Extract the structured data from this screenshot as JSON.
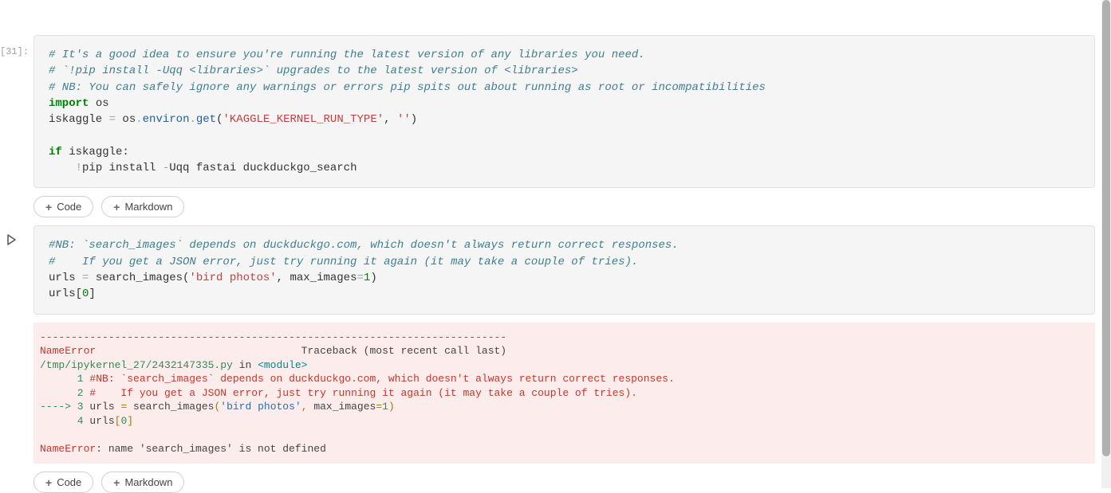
{
  "cell1": {
    "prompt": "[31]:",
    "code": {
      "l1": "# It's a good idea to ensure you're running the latest version of any libraries you need.",
      "l2": "# `!pip install -Uqq <libraries>` upgrades to the latest version of <libraries>",
      "l3": "# NB: You can safely ignore any warnings or errors pip spits out about running as root or incompatibilities",
      "l4a": "import",
      "l4b": " os",
      "l5a": "iskaggle ",
      "l5b": "=",
      "l5c": " os",
      "l5d": ".",
      "l5e": "environ",
      "l5f": ".",
      "l5g": "get",
      "l5h": "(",
      "l5i": "'KAGGLE_KERNEL_RUN_TYPE'",
      "l5j": ", ",
      "l5k": "''",
      "l5l": ")",
      "l7a": "if",
      "l7b": " iskaggle:",
      "l8a": "    ",
      "l8b": "!",
      "l8c": "pip install ",
      "l8d": "-",
      "l8e": "Uqq fastai duckduckgo_search"
    }
  },
  "buttons": {
    "code": "Code",
    "markdown": "Markdown"
  },
  "cell2": {
    "code": {
      "l1": "#NB: `search_images` depends on duckduckgo.com, which doesn't always return correct responses.",
      "l2": "#    If you get a JSON error, just try running it again (it may take a couple of tries).",
      "l3a": "urls ",
      "l3b": "=",
      "l3c": " search_images(",
      "l3d": "'bird photos'",
      "l3e": ", max_images",
      "l3f": "=",
      "l3g": "1",
      "l3h": ")",
      "l4a": "urls[",
      "l4b": "0",
      "l4c": "]"
    },
    "error": {
      "dash": "---------------------------------------------------------------------------",
      "name": "NameError",
      "trace": "                                 Traceback (most recent call last)",
      "file": "/tmp/ipykernel_27/2432147335.py",
      "in": " in ",
      "module": "<module>",
      "p1": "      1 ",
      "c1": "#NB: `search_images` depends on duckduckgo.com, which doesn't always return correct responses.",
      "p2": "      2 ",
      "c2": "#    If you get a JSON error, just try running it again (it may take a couple of tries).",
      "p3": "----> 3 ",
      "c3a": "urls ",
      "c3b": "=",
      "c3c": " search_images",
      "c3d": "(",
      "c3e": "'bird photos'",
      "c3f": ",",
      "c3g": " max_images",
      "c3h": "=",
      "c3i": "1",
      "c3j": ")",
      "p4": "      4 ",
      "c4a": "urls",
      "c4b": "[",
      "c4c": "0",
      "c4d": "]",
      "blank": "",
      "final": ": name 'search_images' is not defined"
    }
  }
}
